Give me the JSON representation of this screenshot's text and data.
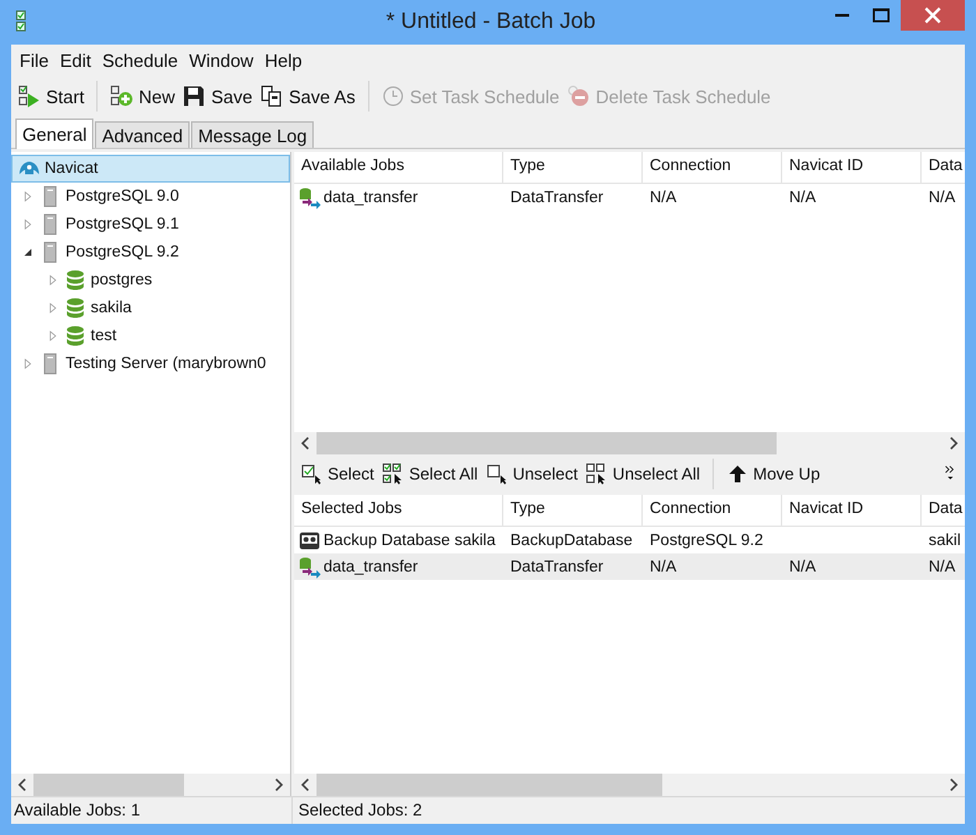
{
  "window": {
    "title": "* Untitled - Batch Job"
  },
  "menu": [
    "File",
    "Edit",
    "Schedule",
    "Window",
    "Help"
  ],
  "toolbar": [
    {
      "items": [
        {
          "kind": "start",
          "label": "Start",
          "disabled": false
        }
      ]
    },
    {
      "items": [
        {
          "kind": "new",
          "label": "New",
          "disabled": false
        },
        {
          "kind": "save",
          "label": "Save",
          "disabled": false
        },
        {
          "kind": "save_as",
          "label": "Save As",
          "disabled": false
        }
      ]
    },
    {
      "items": [
        {
          "kind": "set_schedule",
          "label": "Set Task Schedule",
          "disabled": true
        },
        {
          "kind": "delete_schedule",
          "label": "Delete Task Schedule",
          "disabled": true
        }
      ]
    }
  ],
  "tabs": [
    {
      "label": "General",
      "selected": true
    },
    {
      "label": "Advanced",
      "selected": false
    },
    {
      "label": "Message Log",
      "selected": false
    }
  ],
  "tree": [
    {
      "kind": "root",
      "label": "Navicat",
      "selected": true,
      "children": [
        {
          "kind": "server",
          "label": "PostgreSQL 9.0",
          "expanded": false,
          "selected": false
        },
        {
          "kind": "server",
          "label": "PostgreSQL 9.1",
          "expanded": false,
          "selected": false
        },
        {
          "kind": "server",
          "label": "PostgreSQL 9.2",
          "expanded": true,
          "selected": false,
          "children": [
            {
              "kind": "database",
              "label": "postgres",
              "expanded": false,
              "selected": false
            },
            {
              "kind": "database",
              "label": "sakila",
              "expanded": false,
              "selected": false
            },
            {
              "kind": "database",
              "label": "test",
              "expanded": false,
              "selected": false
            }
          ]
        },
        {
          "kind": "server",
          "label": "Testing Server (marybrown0",
          "expanded": false,
          "selected": false
        }
      ]
    }
  ],
  "available_jobs": {
    "columns": [
      "Available Jobs",
      "Type",
      "Connection",
      "Navicat ID",
      "Data"
    ],
    "rows": [
      {
        "kind": "transfer",
        "selected": false,
        "cells": [
          "data_transfer",
          "DataTransfer",
          "N/A",
          "N/A",
          "N/A"
        ]
      }
    ]
  },
  "job_toolbar": [
    {
      "items": [
        {
          "kind": "select",
          "label": "Select"
        },
        {
          "kind": "select_all",
          "label": "Select All"
        },
        {
          "kind": "unselect",
          "label": "Unselect"
        },
        {
          "kind": "unselect_all",
          "label": "Unselect All"
        }
      ]
    },
    {
      "items": [
        {
          "kind": "move_up",
          "label": "Move Up"
        }
      ]
    }
  ],
  "selected_jobs": {
    "columns": [
      "Selected Jobs",
      "Type",
      "Connection",
      "Navicat ID",
      "Data"
    ],
    "rows": [
      {
        "kind": "backup",
        "selected": false,
        "cells": [
          "Backup Database sakila",
          "BackupDatabase",
          "PostgreSQL 9.2",
          "",
          "sakil"
        ]
      },
      {
        "kind": "transfer",
        "selected": true,
        "cells": [
          "data_transfer",
          "DataTransfer",
          "N/A",
          "N/A",
          "N/A"
        ]
      }
    ]
  },
  "status_bar": [
    "Available Jobs: 1",
    "Selected Jobs: 2"
  ]
}
